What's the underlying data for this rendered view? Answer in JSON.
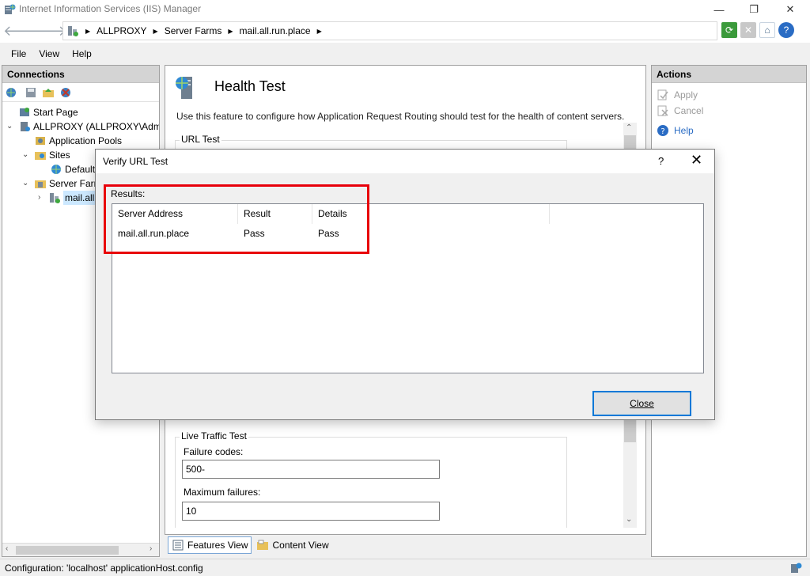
{
  "window": {
    "title": "Internet Information Services (IIS) Manager"
  },
  "breadcrumb": [
    "ALLPROXY",
    "Server Farms",
    "mail.all.run.place"
  ],
  "menu": {
    "file": "File",
    "view": "View",
    "help": "Help"
  },
  "connections": {
    "header": "Connections",
    "tree": {
      "start_page": "Start Page",
      "server": "ALLPROXY (ALLPROXY\\Admi",
      "app_pools": "Application Pools",
      "sites": "Sites",
      "default_site": "Default",
      "server_farms": "Server Farm",
      "farm": "mail.all"
    }
  },
  "feature": {
    "title": "Health Test",
    "description": "Use this feature to configure how Application Request Routing should test for the health of content servers.",
    "url_test_group": "URL Test",
    "live_traffic_group": "Live Traffic Test",
    "failure_codes_label": "Failure codes:",
    "failure_codes_value": "500-",
    "max_failures_label": "Maximum failures:",
    "max_failures_value": "10"
  },
  "view_tabs": {
    "features": "Features View",
    "content": "Content View"
  },
  "actions": {
    "header": "Actions",
    "apply": "Apply",
    "cancel": "Cancel",
    "help": "Help"
  },
  "status": {
    "text": "Configuration: 'localhost' applicationHost.config"
  },
  "dialog": {
    "title": "Verify URL Test",
    "help_glyph": "?",
    "results_label": "Results:",
    "columns": [
      "Server Address",
      "Result",
      "Details"
    ],
    "rows": [
      [
        "mail.all.run.place",
        "Pass",
        "Pass"
      ]
    ],
    "close_label": "Close"
  },
  "colors": {
    "highlight": "#e8000b",
    "selection": "#cce8ff",
    "focus_border": "#0078d7"
  }
}
